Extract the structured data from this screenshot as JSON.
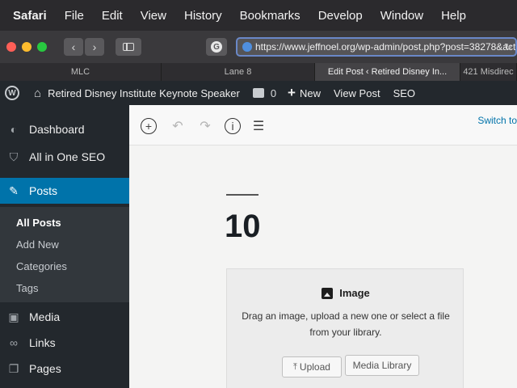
{
  "menubar": {
    "items": [
      "Safari",
      "File",
      "Edit",
      "View",
      "History",
      "Bookmarks",
      "Develop",
      "Window",
      "Help"
    ]
  },
  "toolbar": {
    "back_icon": "chevron-left-icon",
    "forward_icon": "chevron-right-icon",
    "grammarly_label": "G",
    "url": "https://www.jeffnoel.org/wp-admin/post.php?post=38278&acti"
  },
  "tabs": [
    {
      "label": "MLC"
    },
    {
      "label": "Lane 8"
    },
    {
      "label": "Edit Post ‹ Retired Disney In..."
    },
    {
      "label": "421 Misdirec"
    }
  ],
  "adminbar": {
    "site_name": "Retired Disney Institute Keynote Speaker",
    "comments_count": "0",
    "new_label": "New",
    "view_post_label": "View Post",
    "seo_label": "SEO"
  },
  "sidebar": {
    "items": [
      {
        "label": "Dashboard",
        "icon": "dashboard-icon"
      },
      {
        "label": "All in One SEO",
        "icon": "shield-icon"
      },
      {
        "label": "Posts",
        "icon": "pushpin-icon"
      },
      {
        "label": "Media",
        "icon": "media-icon"
      },
      {
        "label": "Links",
        "icon": "link-icon"
      },
      {
        "label": "Pages",
        "icon": "pages-icon"
      }
    ],
    "posts_submenu": [
      "All Posts",
      "Add New",
      "Categories",
      "Tags"
    ]
  },
  "editor": {
    "switch_label": "Switch to",
    "post_title": "10",
    "image_block": {
      "label": "Image",
      "description_line1": "Drag an image, upload a new one or select a file",
      "description_line2": "from your library.",
      "upload_label": "Upload",
      "media_library_label": "Media Library"
    }
  },
  "colors": {
    "admin_dark": "#23282d",
    "accent_blue": "#0073aa",
    "editor_bg": "#f4f4f3"
  }
}
